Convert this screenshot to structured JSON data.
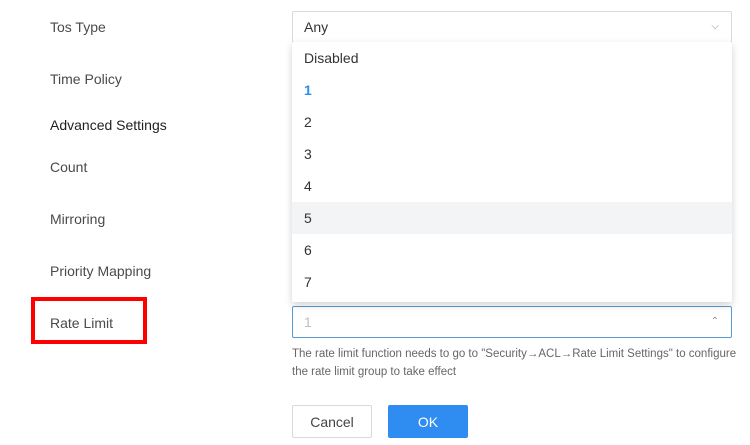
{
  "labels": {
    "tos_type": "Tos Type",
    "time_policy": "Time Policy",
    "advanced_settings": "Advanced Settings",
    "count": "Count",
    "mirroring": "Mirroring",
    "priority_mapping": "Priority Mapping",
    "rate_limit": "Rate Limit"
  },
  "tos_type_select": {
    "value": "Any"
  },
  "rate_limit_select": {
    "value": "1"
  },
  "rate_limit_options": [
    "Disabled",
    "1",
    "2",
    "3",
    "4",
    "5",
    "6",
    "7"
  ],
  "rate_limit_selected": "1",
  "rate_limit_hovered": "5",
  "hint": "The rate limit function needs to go to \"Security→ACL→Rate Limit Settings\" to configure the rate limit group to take effect",
  "buttons": {
    "cancel": "Cancel",
    "ok": "OK"
  },
  "colors": {
    "accent": "#2f8cf0",
    "highlight": "#ff0000",
    "hover_bg": "#f3f4f6"
  }
}
